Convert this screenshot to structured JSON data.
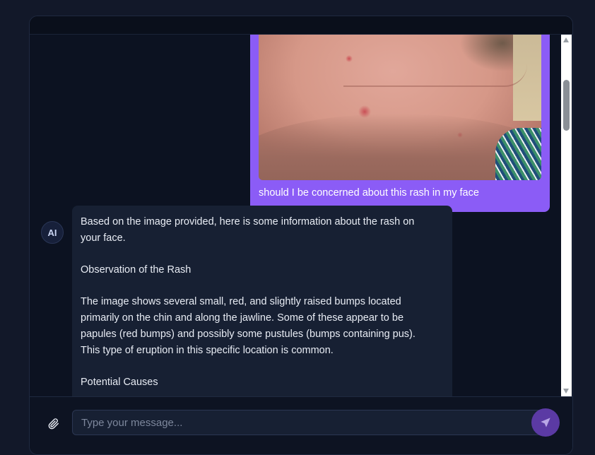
{
  "conversation": {
    "user_message": {
      "text": "should I be concerned about this rash in my face"
    },
    "ai_message": {
      "avatar_label": "AI",
      "paragraphs": [
        "Based on the image provided, here is some information about the rash on your face.",
        "Observation of the Rash",
        "The image shows several small, red, and slightly raised bumps located primarily on the chin and along the jawline. Some of these appear to be papules (red bumps) and possibly some pustules (bumps containing pus). This type of eruption in this specific location is common.",
        "Potential Causes"
      ]
    }
  },
  "composer": {
    "placeholder": "Type your message...",
    "value": ""
  },
  "icons": {
    "attach": "paperclip-icon",
    "send": "send-icon",
    "scroll_up": "chevron-up-icon",
    "scroll_down": "chevron-down-icon"
  },
  "colors": {
    "page_background": "#121829",
    "user_bubble": "#8b5cf6",
    "ai_bubble": "#172033",
    "send_button": "#5b3aa4"
  }
}
